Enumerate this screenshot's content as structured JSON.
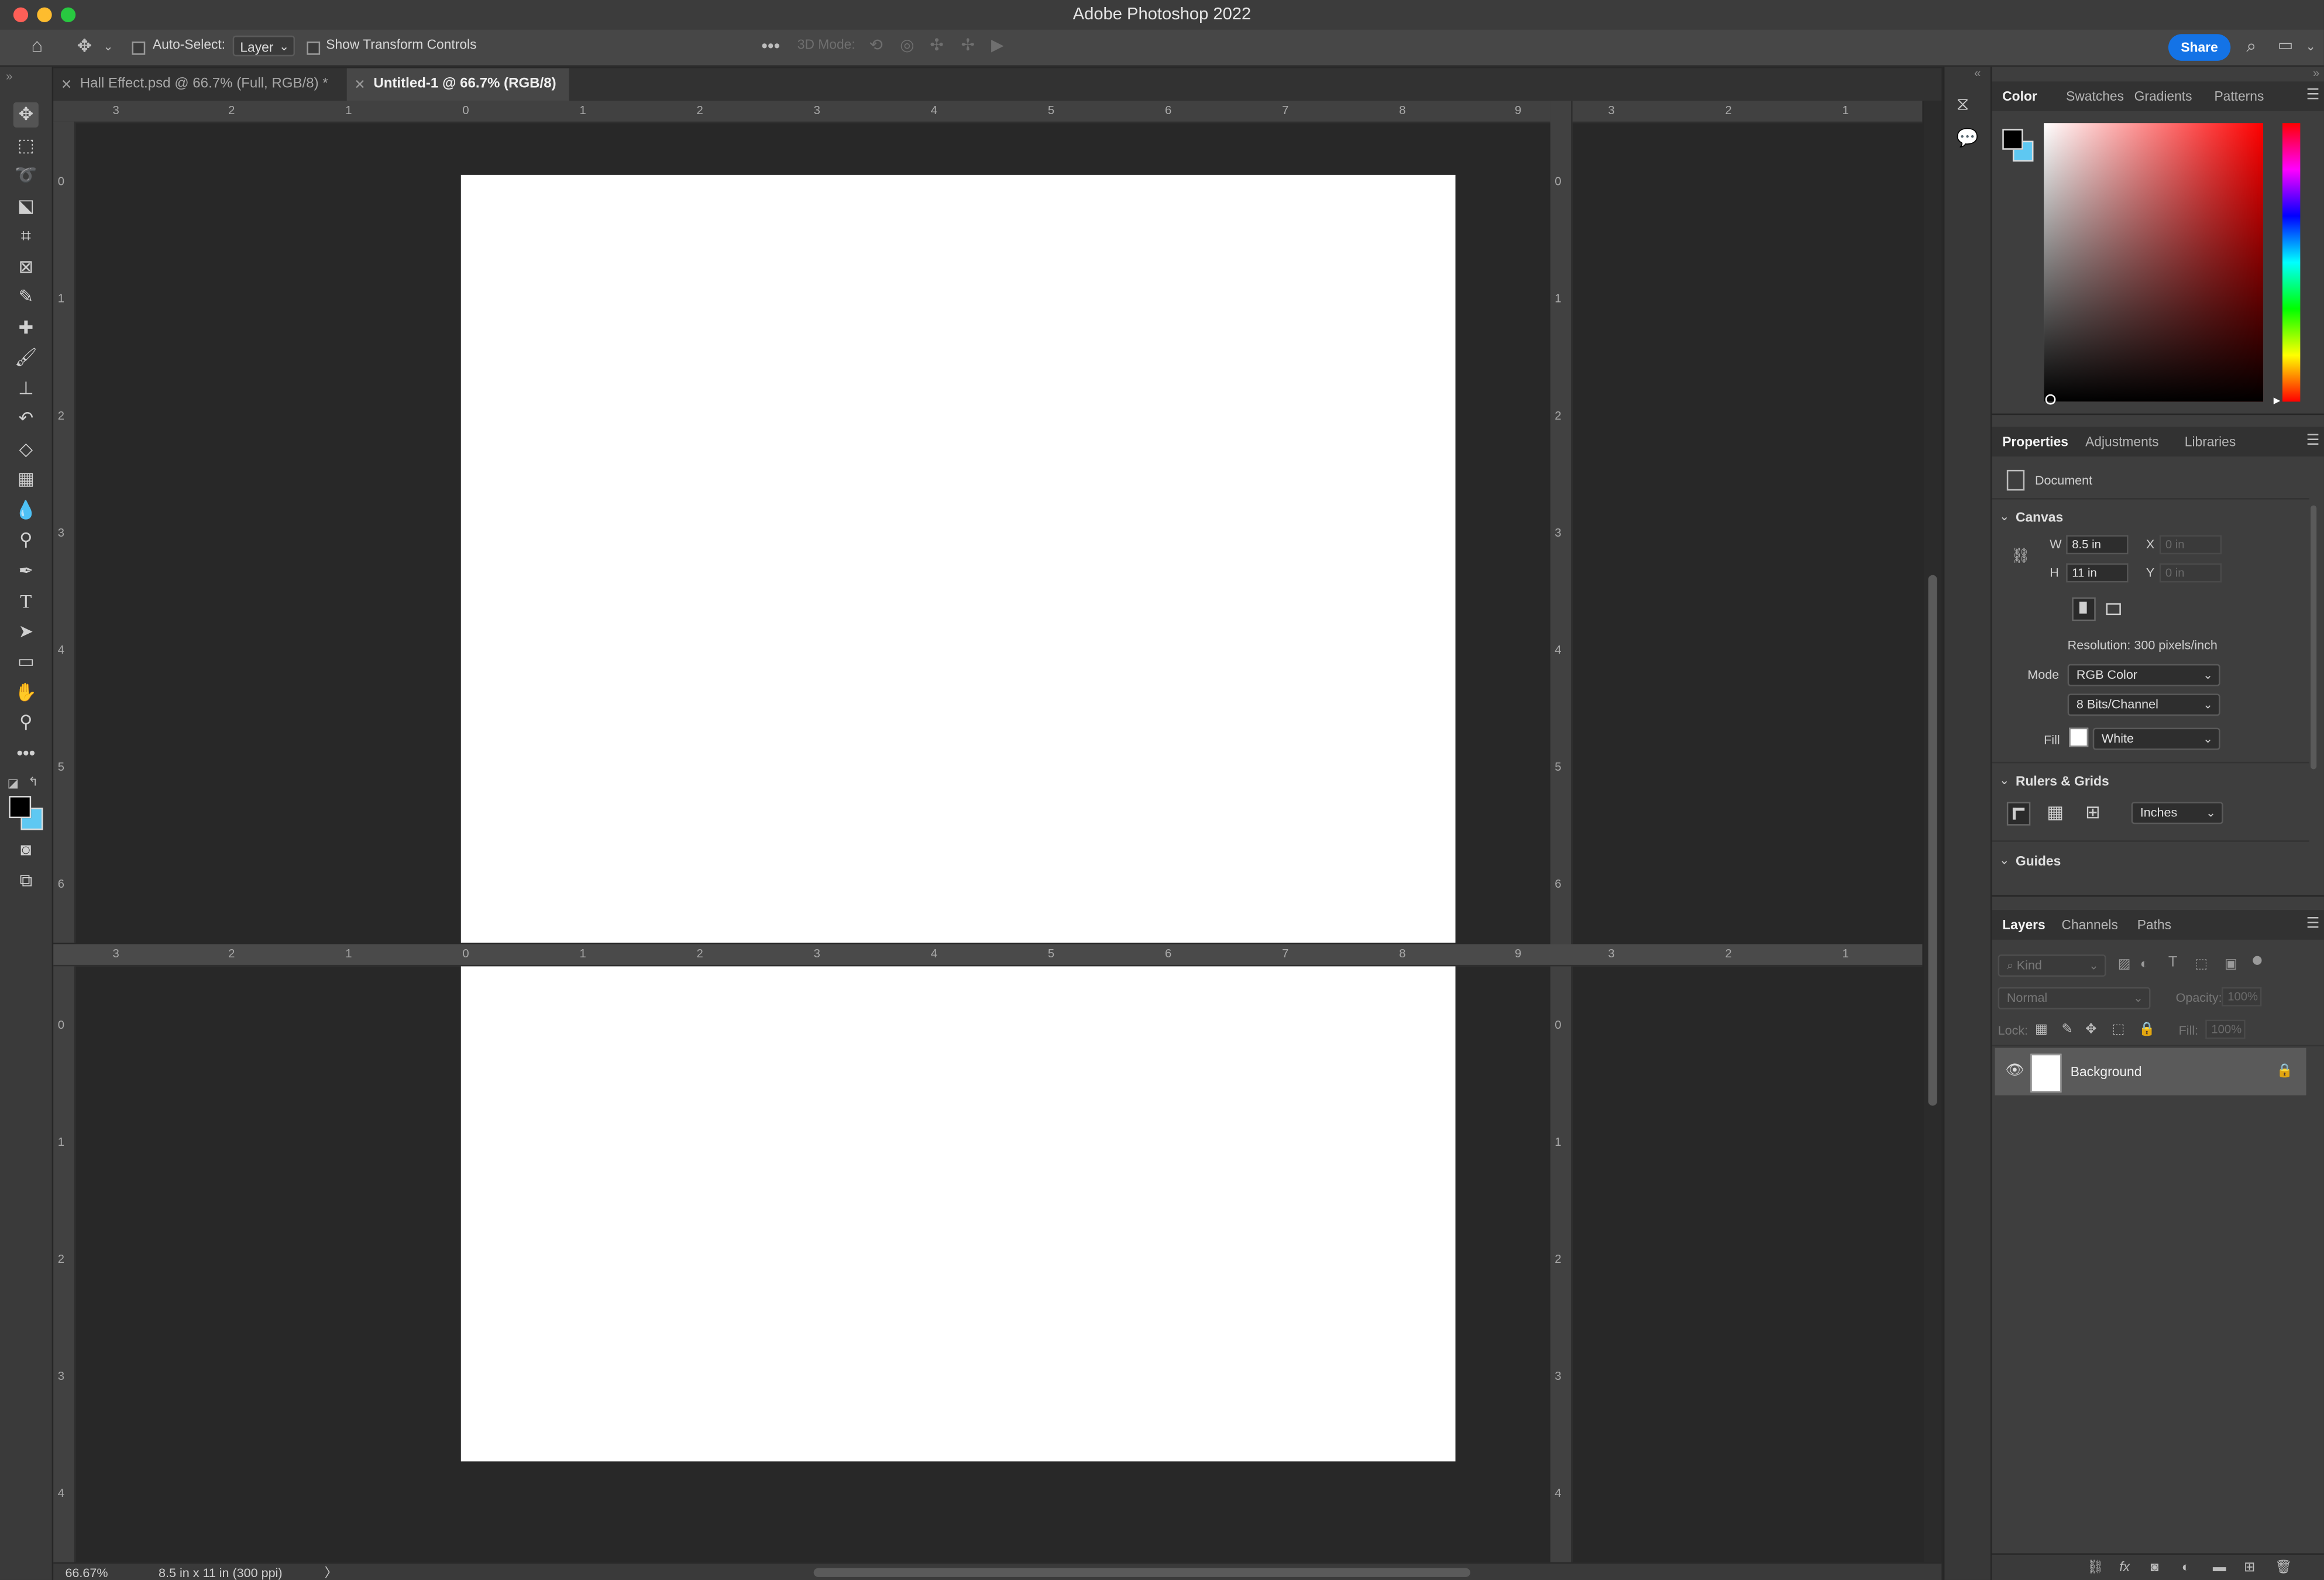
{
  "window": {
    "title": "Adobe Photoshop 2022"
  },
  "options_bar": {
    "auto_select_label": "Auto-Select:",
    "auto_select_target": "Layer",
    "transform_controls_label": "Show Transform Controls",
    "mode_3d_label": "3D Mode:",
    "share_label": "Share"
  },
  "tabs": [
    {
      "label": "Hall Effect.psd @ 66.7% (Full, RGB/8) *",
      "active": false
    },
    {
      "label": "Untitled-1 @ 66.7% (RGB/8)",
      "active": true
    }
  ],
  "rulers": {
    "horizontal": [
      "3",
      "2",
      "1",
      "0",
      "1",
      "2",
      "3",
      "4",
      "5",
      "6",
      "7",
      "8",
      "9",
      "3",
      "2",
      "1"
    ],
    "vertical_top": [
      "0",
      "1",
      "2",
      "3",
      "4",
      "5",
      "6"
    ],
    "vertical_bottom": [
      "0",
      "1",
      "2",
      "3",
      "4"
    ]
  },
  "status": {
    "zoom": "66.67%",
    "doc_info": "8.5 in x 11 in (300 ppi)",
    "arrow": "〉"
  },
  "color_panel": {
    "tabs": [
      "Color",
      "Swatches",
      "Gradients",
      "Patterns"
    ],
    "active_tab": "Color"
  },
  "properties_panel": {
    "tabs": [
      "Properties",
      "Adjustments",
      "Libraries"
    ],
    "active_tab": "Properties",
    "document_label": "Document",
    "canvas": {
      "section": "Canvas",
      "w_label": "W",
      "w_value": "8.5 in",
      "h_label": "H",
      "h_value": "11 in",
      "x_label": "X",
      "x_value": "0 in",
      "y_label": "Y",
      "y_value": "0 in",
      "resolution": "Resolution: 300 pixels/inch",
      "mode_label": "Mode",
      "mode_value": "RGB Color",
      "bits_value": "8 Bits/Channel",
      "fill_label": "Fill",
      "fill_value": "White"
    },
    "rulers_grids": {
      "section": "Rulers & Grids",
      "units": "Inches"
    },
    "guides": {
      "section": "Guides"
    }
  },
  "layers_panel": {
    "tabs": [
      "Layers",
      "Channels",
      "Paths"
    ],
    "active_tab": "Layers",
    "filter_placeholder": "Kind",
    "blend_mode": "Normal",
    "opacity_label": "Opacity:",
    "opacity_value": "100%",
    "lock_label": "Lock:",
    "fill_label": "Fill:",
    "fill_value": "100%",
    "layers": [
      {
        "name": "Background",
        "visible": true,
        "locked": true
      }
    ]
  },
  "colors": {
    "accent": "#1473e6",
    "foreground": "#000000",
    "background": "#5ec8f2"
  }
}
